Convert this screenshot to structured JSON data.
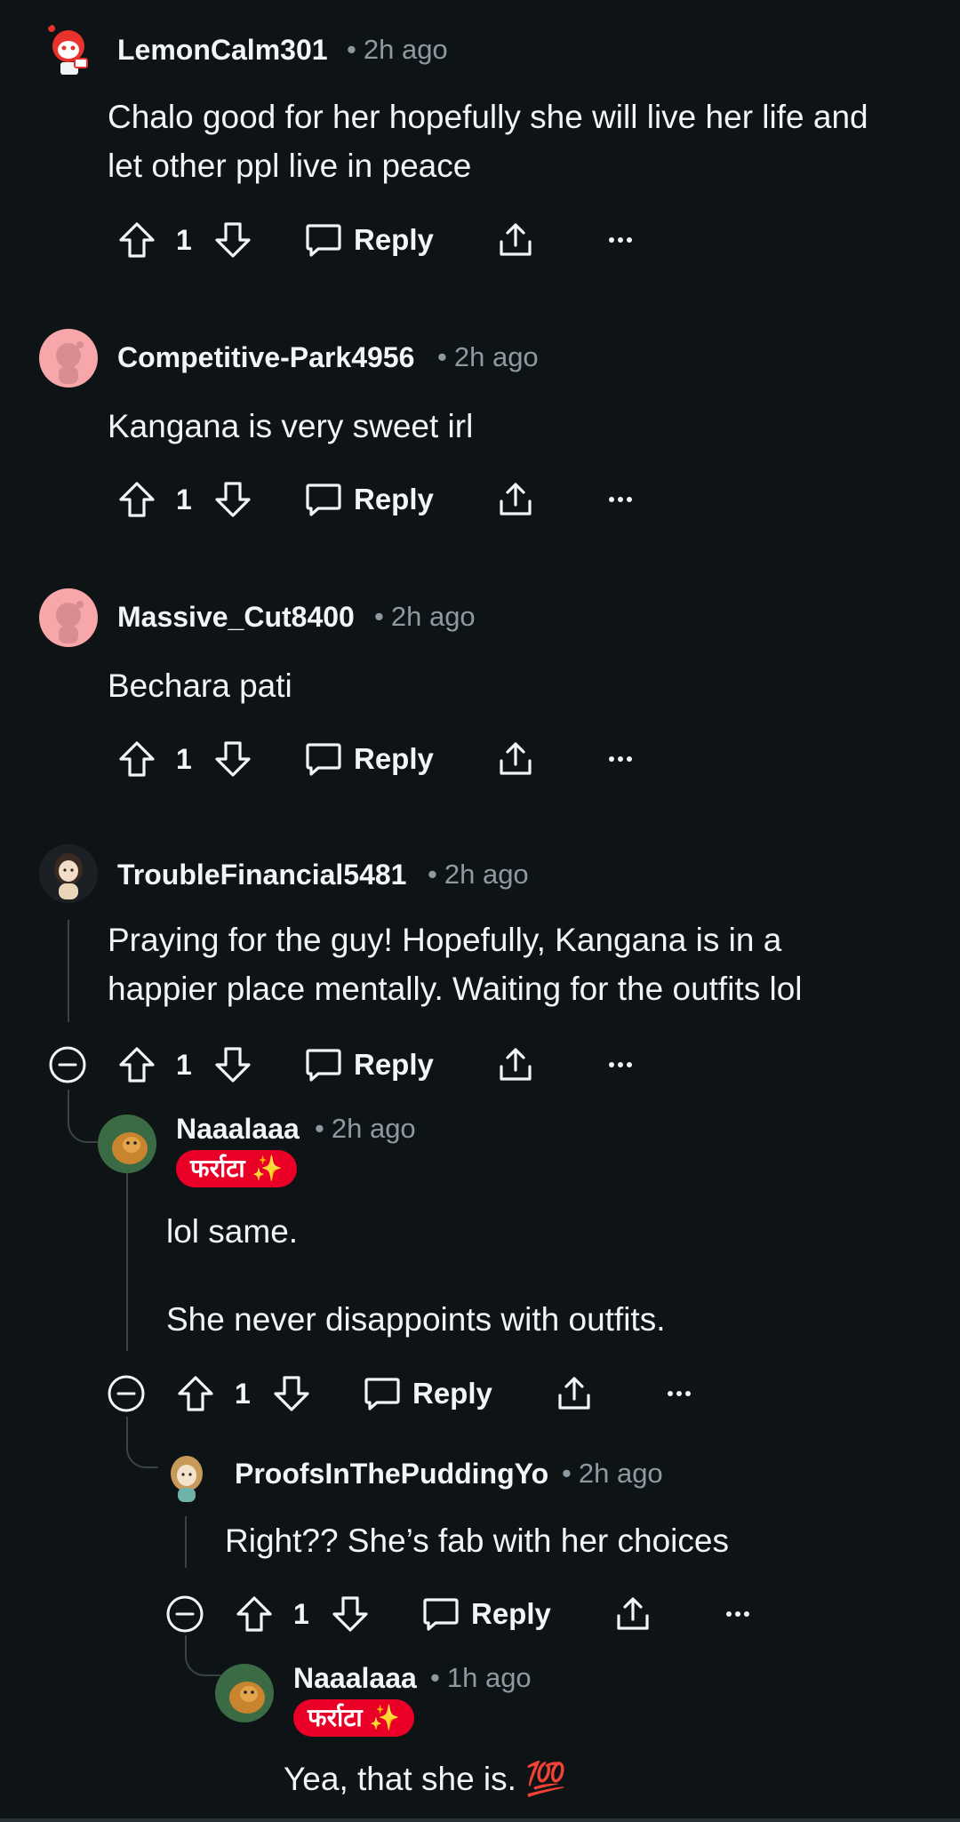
{
  "comments": [
    {
      "username": "LemonCalm301",
      "time": "2h ago",
      "lines": [
        "Chalo good for her hopefully she will live her life and",
        "let other ppl live in peace"
      ],
      "votes": "1",
      "reply_label": "Reply"
    },
    {
      "username": "Competitive-Park4956",
      "time": "2h ago",
      "lines": [
        "Kangana is very sweet irl"
      ],
      "votes": "1",
      "reply_label": "Reply"
    },
    {
      "username": "Massive_Cut8400",
      "time": "2h ago",
      "lines": [
        "Bechara pati"
      ],
      "votes": "1",
      "reply_label": "Reply"
    },
    {
      "username": "TroubleFinancial5481",
      "time": "2h ago",
      "lines": [
        "Praying for the guy! Hopefully, Kangana is in a",
        "happier place mentally. Waiting for the outfits lol"
      ],
      "votes": "1",
      "reply_label": "Reply"
    },
    {
      "username": "Naaalaaa",
      "flair": "फर्राटा ✨",
      "time": "2h ago",
      "lines": [
        "lol same.",
        "She never disappoints with outfits."
      ],
      "votes": "1",
      "reply_label": "Reply"
    },
    {
      "username": "ProofsInThePuddingYo",
      "time": "2h ago",
      "lines": [
        "Right?? She’s fab with her choices"
      ],
      "votes": "1",
      "reply_label": "Reply"
    },
    {
      "username": "Naaalaaa",
      "flair": "फर्राटा ✨",
      "time": "1h ago",
      "lines": [
        "Yea, that she is. 💯"
      ]
    }
  ],
  "colors": {
    "background": "#0e1316",
    "text": "#f2f4f5",
    "muted": "#8e9aa1",
    "flair": "#ea0027",
    "thread_line": "#3a4247"
  },
  "icons": [
    "upvote-icon",
    "downvote-icon",
    "comment-icon",
    "share-icon",
    "more-icon",
    "collapse-icon"
  ]
}
